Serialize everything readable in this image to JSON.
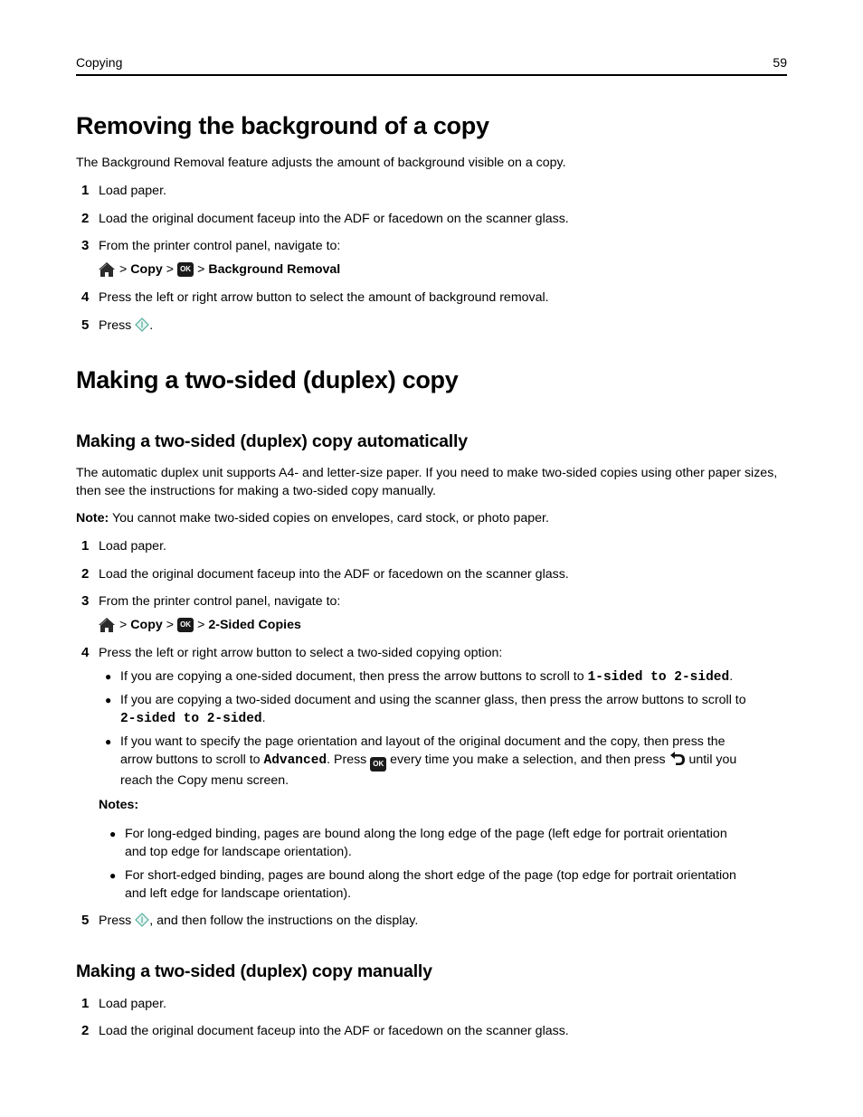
{
  "header": {
    "section": "Copying",
    "page_number": "59"
  },
  "section1": {
    "title": "Removing the background of a copy",
    "intro": "The Background Removal feature adjusts the amount of background visible on a copy.",
    "steps": [
      {
        "num": "1",
        "text": "Load paper."
      },
      {
        "num": "2",
        "text": "Load the original document faceup into the ADF or facedown on the scanner glass."
      },
      {
        "num": "3",
        "text": "From the printer control panel, navigate to:"
      },
      {
        "num": "4",
        "text": "Press the left or right arrow button to select the amount of background removal."
      },
      {
        "num": "5",
        "text_before": "Press ",
        "text_after": "."
      }
    ],
    "nav_path": {
      "sep": ">",
      "item1": "Copy",
      "item2": "Background Removal"
    }
  },
  "section2": {
    "title": "Making a two-sided (duplex) copy",
    "auto": {
      "title": "Making a two-sided (duplex) copy automatically",
      "intro": "The automatic duplex unit supports A4- and letter-size paper. If you need to make two-sided copies using other paper sizes, then see the instructions for making a two-sided copy manually.",
      "note_label": "Note:",
      "note_text": " You cannot make two-sided copies on envelopes, card stock, or photo paper.",
      "steps": [
        {
          "num": "1",
          "text": "Load paper."
        },
        {
          "num": "2",
          "text": "Load the original document faceup into the ADF or facedown on the scanner glass."
        },
        {
          "num": "3",
          "text": "From the printer control panel, navigate to:"
        },
        {
          "num": "4",
          "text": "Press the left or right arrow button to select a two-sided copying option:"
        },
        {
          "num": "5",
          "text_before": "Press ",
          "text_after": ", and then follow the instructions on the display."
        }
      ],
      "nav_path": {
        "sep": ">",
        "item1": "Copy",
        "item2": "2-Sided Copies"
      },
      "bullets": [
        {
          "text": "If you are copying a one-sided document, then press the arrow buttons to scroll to ",
          "code": "1-sided to 2-sided",
          "end": "."
        },
        {
          "text": "If you are copying a two-sided document and using the scanner glass, then press the arrow buttons to scroll to",
          "code": "2-sided to 2-sided",
          "end": "."
        },
        {
          "line1": "If you want to specify the page orientation and layout of the original document and the copy, then press the",
          "line2_a": "arrow buttons to scroll to ",
          "code": "Advanced",
          "line2_b": ". Press ",
          "line2_c": " every time you make a selection, and then press ",
          "line2_d": " until you",
          "line3": "reach the Copy menu screen."
        }
      ],
      "notes_label": "Notes:",
      "notes": [
        {
          "line1": "For long-edged binding, pages are bound along the long edge of the page (left edge for portrait orientation",
          "line2": "and top edge for landscape orientation)."
        },
        {
          "line1": "For short-edged binding, pages are bound along the short edge of the page (top edge for portrait orientation",
          "line2": "and left edge for landscape orientation)."
        }
      ]
    },
    "manual": {
      "title": "Making a two-sided (duplex) copy manually",
      "steps": [
        {
          "num": "1",
          "text": "Load paper."
        },
        {
          "num": "2",
          "text": "Load the original document faceup into the ADF or facedown on the scanner glass."
        }
      ]
    }
  },
  "icons": {
    "ok_label": "OK"
  }
}
